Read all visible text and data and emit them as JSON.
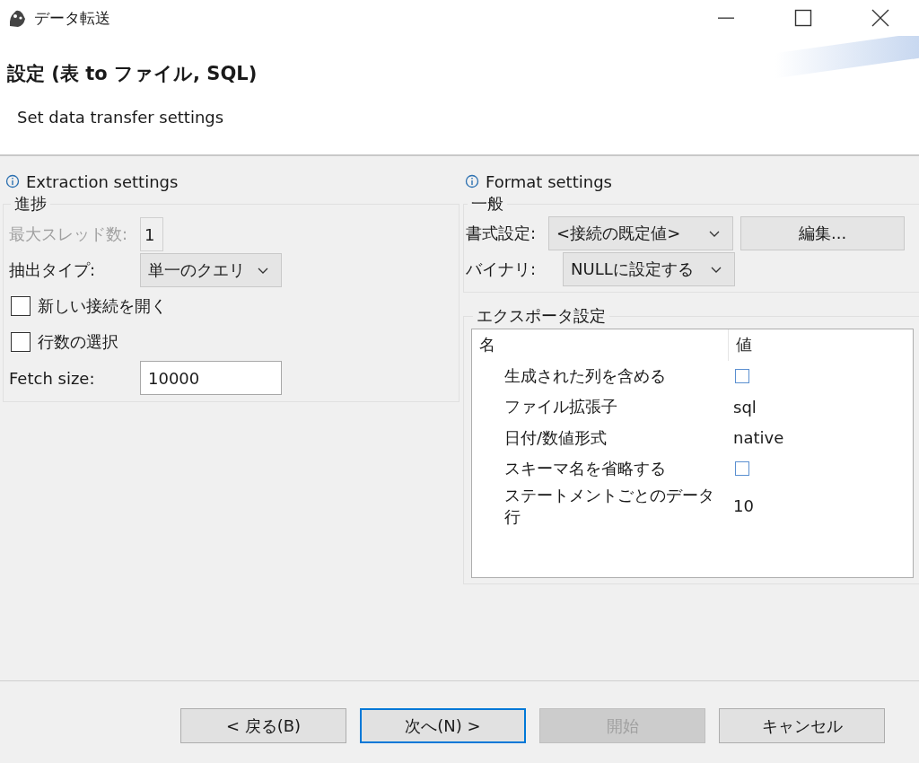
{
  "window": {
    "title": "データ転送"
  },
  "header": {
    "title": "設定 (表 to ファイル, SQL)",
    "subtitle": "Set data transfer settings"
  },
  "extraction": {
    "heading": "Extraction settings",
    "group": "進捗",
    "rows": [
      {
        "kind": "spinner",
        "label": "最大スレッド数:",
        "value": "1",
        "disabled": true
      },
      {
        "kind": "dropdown",
        "label": "抽出タイプ:",
        "value": "単一のクエリ",
        "disabled": false
      },
      {
        "kind": "checkbox",
        "label": "新しい接続を開く",
        "checked": false,
        "disabled": false
      },
      {
        "kind": "checkbox",
        "label": "行数の選択",
        "checked": false,
        "disabled": false
      },
      {
        "kind": "text",
        "label": "Fetch size:",
        "value": "10000",
        "disabled": false
      }
    ]
  },
  "format": {
    "heading": "Format settings",
    "group": "一般",
    "formatting": {
      "label": "書式設定:",
      "value": "<接続の既定値>"
    },
    "edit_button": "編集...",
    "binary": {
      "label": "バイナリ:",
      "value": "NULLに設定する"
    },
    "exporter": {
      "group": "エクスポータ設定",
      "columns": [
        "名",
        "値"
      ],
      "rows": [
        {
          "name": "生成された列を含める",
          "kind": "checkbox",
          "checked": false
        },
        {
          "name": "ファイル拡張子",
          "kind": "text",
          "value": "sql"
        },
        {
          "name": "日付/数値形式",
          "kind": "text",
          "value": "native"
        },
        {
          "name": "スキーマ名を省略する",
          "kind": "checkbox",
          "checked": false
        },
        {
          "name": "ステートメントごとのデータ行",
          "kind": "text",
          "value": "10"
        }
      ]
    }
  },
  "buttons": [
    {
      "label": "< 戻る(B)",
      "disabled": false,
      "focused": false
    },
    {
      "label": "次へ(N) >",
      "disabled": false,
      "focused": true
    },
    {
      "label": "開始",
      "disabled": true,
      "focused": false
    },
    {
      "label": "キャンセル",
      "disabled": false,
      "focused": false
    }
  ]
}
